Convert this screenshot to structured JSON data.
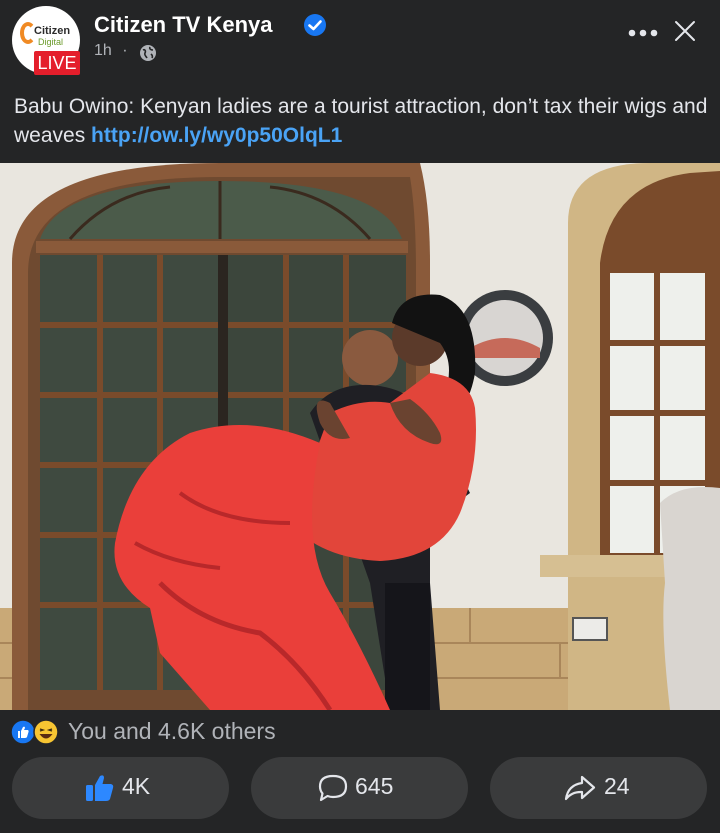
{
  "post": {
    "page_name": "Citizen TV Kenya",
    "time": "1h",
    "separator": "·",
    "avatar_logo_line1": "Citizen",
    "avatar_logo_line2": "Digital",
    "live_label": "LIVE",
    "text": "Babu Owino: Kenyan ladies are a tourist attraction, don’t tax their wigs and weaves ",
    "link": "http://ow.ly/wy0p50OlqL1"
  },
  "reactions": {
    "icons": [
      "like-icon",
      "haha-icon"
    ],
    "summary": "You and 4.6K others"
  },
  "actions": [
    {
      "icon": "thumbs-up-icon",
      "count": "4K"
    },
    {
      "icon": "comment-icon",
      "count": "645"
    },
    {
      "icon": "share-icon",
      "count": "24"
    }
  ],
  "colors": {
    "background": "#242526",
    "button": "#3a3b3c",
    "link": "#4aa3f5",
    "like_blue": "#1877f2",
    "live_red": "#e41e2b"
  }
}
